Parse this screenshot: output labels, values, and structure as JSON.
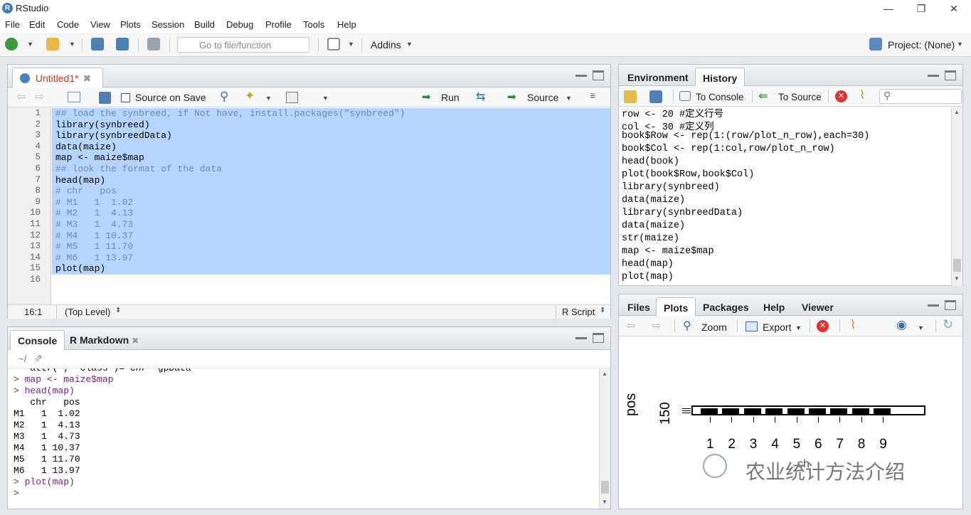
{
  "window": {
    "title": "RStudio",
    "logo_letter": "R",
    "minimize": "—",
    "restore": "❐",
    "close": "✕"
  },
  "menu": [
    "File",
    "Edit",
    "Code",
    "View",
    "Plots",
    "Session",
    "Build",
    "Debug",
    "Profile",
    "Tools",
    "Help"
  ],
  "toolbar": {
    "goto_placeholder": "Go to file/function",
    "addins_label": "Addins",
    "project_label": "Project: (None)"
  },
  "editor": {
    "tab_label": "Untitled1*",
    "source_on_save": "Source on Save",
    "run_label": "Run",
    "source_label": "Source",
    "lines": [
      {
        "n": "1",
        "text": "## load the synbreed, if Not have, install.packages(\"synbreed\")",
        "type": "comment"
      },
      {
        "n": "2",
        "text": "library(synbreed)",
        "type": "code"
      },
      {
        "n": "3",
        "text": "library(synbreedData)",
        "type": "code"
      },
      {
        "n": "4",
        "text": "data(maize)",
        "type": "code"
      },
      {
        "n": "5",
        "text": "map <- maize$map",
        "type": "code"
      },
      {
        "n": "6",
        "text": "## look the format of the data",
        "type": "comment"
      },
      {
        "n": "7",
        "text": "head(map)",
        "type": "code"
      },
      {
        "n": "8",
        "text": "# chr   pos",
        "type": "comment"
      },
      {
        "n": "9",
        "text": "# M1   1  1.02",
        "type": "comment"
      },
      {
        "n": "10",
        "text": "# M2   1  4.13",
        "type": "comment"
      },
      {
        "n": "11",
        "text": "# M3   1  4.73",
        "type": "comment"
      },
      {
        "n": "12",
        "text": "# M4   1 10.37",
        "type": "comment"
      },
      {
        "n": "13",
        "text": "# M5   1 11.70",
        "type": "comment"
      },
      {
        "n": "14",
        "text": "# M6   1 13.97",
        "type": "comment"
      },
      {
        "n": "15",
        "text": "plot(map)",
        "type": "code"
      },
      {
        "n": "16",
        "text": "",
        "type": "code"
      }
    ],
    "status_position": "16:1",
    "status_scope": "(Top Level)",
    "status_type": "R Script"
  },
  "console": {
    "tab_console": "Console",
    "tab_rmarkdown": "R Markdown",
    "path": "~/",
    "lines": [
      {
        "text": " - attr(*, \"class\")= chr  gpData",
        "prompt": false
      },
      {
        "text": "> map <- maize$map",
        "prompt": true
      },
      {
        "text": "> head(map)",
        "prompt": true
      },
      {
        "text": "   chr   pos",
        "prompt": false
      },
      {
        "text": "M1   1  1.02",
        "prompt": false
      },
      {
        "text": "M2   1  4.13",
        "prompt": false
      },
      {
        "text": "M3   1  4.73",
        "prompt": false
      },
      {
        "text": "M4   1 10.37",
        "prompt": false
      },
      {
        "text": "M5   1 11.70",
        "prompt": false
      },
      {
        "text": "M6   1 13.97",
        "prompt": false
      },
      {
        "text": "> plot(map)",
        "prompt": true
      },
      {
        "text": "> ",
        "prompt": true
      }
    ]
  },
  "env_pane": {
    "tab_environment": "Environment",
    "tab_history": "History",
    "to_console": "To Console",
    "to_source": "To Source",
    "history": [
      "row <- 20 #定义行号",
      "col <- 30 #定义列",
      "book$Row <- rep(1:(row/plot_n_row),each=30)",
      "book$Col <- rep(1:col,row/plot_n_row)",
      "head(book)",
      "plot(book$Row,book$Col)",
      "library(synbreed)",
      "data(maize)",
      "library(synbreedData)",
      "data(maize)",
      "str(maize)",
      "map <- maize$map",
      "head(map)",
      "plot(map)"
    ]
  },
  "files_pane": {
    "tabs": [
      "Files",
      "Plots",
      "Packages",
      "Help",
      "Viewer"
    ],
    "zoom_label": "Zoom",
    "export_label": "Export"
  },
  "plot": {
    "ylabel": "pos",
    "ytick": "150",
    "xticks": [
      "1",
      "2",
      "3",
      "4",
      "5",
      "6",
      "7",
      "8",
      "9"
    ],
    "xlabel_partial": "ch",
    "watermark": "农业统计方法介绍"
  }
}
